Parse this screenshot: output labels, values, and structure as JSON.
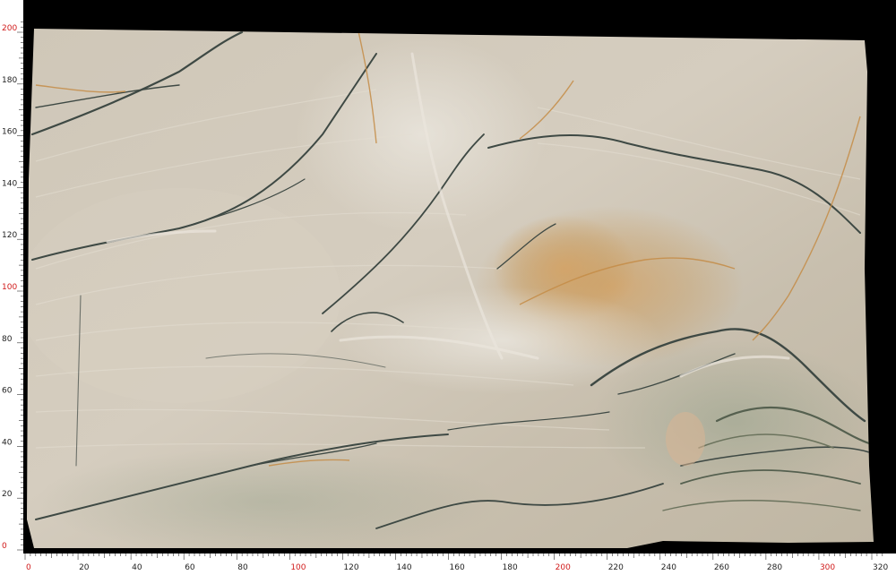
{
  "image": {
    "subject": "marble-slab",
    "background_color": "#000000",
    "slab_base_color": "#c9c0b0",
    "vein_color_dark": "#3f4a46",
    "vein_color_light": "#e6e2da",
    "vein_color_gold": "#c9954e"
  },
  "ruler": {
    "unit_color_major": "#d11a1a",
    "unit_color_minor": "#222222",
    "x_labels": [
      "0",
      "20",
      "40",
      "60",
      "80",
      "100",
      "120",
      "140",
      "160",
      "180",
      "200",
      "220",
      "240",
      "260",
      "280",
      "300",
      "320"
    ],
    "x_major": [
      "0",
      "100",
      "200",
      "300"
    ],
    "y_labels": [
      "0",
      "20",
      "40",
      "60",
      "80",
      "100",
      "120",
      "140",
      "160",
      "180",
      "200"
    ],
    "y_major": [
      "0",
      "100",
      "200"
    ]
  }
}
